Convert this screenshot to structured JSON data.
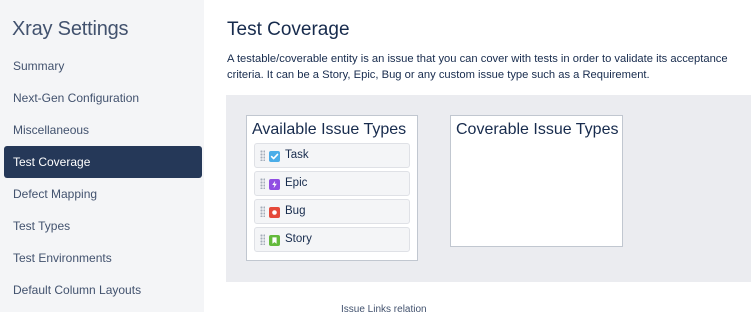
{
  "sidebar": {
    "title": "Xray Settings",
    "items": [
      {
        "label": "Summary"
      },
      {
        "label": "Next-Gen Configuration"
      },
      {
        "label": "Miscellaneous"
      },
      {
        "label": "Test Coverage",
        "active": true
      },
      {
        "label": "Defect Mapping"
      },
      {
        "label": "Test Types"
      },
      {
        "label": "Test Environments"
      },
      {
        "label": "Default Column Layouts"
      }
    ]
  },
  "main": {
    "title": "Test Coverage",
    "description": "A testable/coverable entity is an issue that you can cover with tests in order to validate its acceptance criteria. It can be a Story, Epic, Bug or any custom issue type such as a Requirement.",
    "available": {
      "title": "Available Issue Types",
      "items": [
        {
          "label": "Task",
          "icon": "task-icon",
          "color": "#4bade8"
        },
        {
          "label": "Epic",
          "icon": "epic-icon",
          "color": "#904ee2"
        },
        {
          "label": "Bug",
          "icon": "bug-icon",
          "color": "#e5493a"
        },
        {
          "label": "Story",
          "icon": "story-icon",
          "color": "#63ba3c"
        }
      ]
    },
    "coverable": {
      "title": "Coverable Issue Types",
      "items": []
    },
    "links_caption": "Issue Links relation"
  },
  "colors": {
    "sidebar_bg": "#f4f5f7",
    "active_bg": "#253858",
    "panel_bg": "#ebecf0"
  }
}
